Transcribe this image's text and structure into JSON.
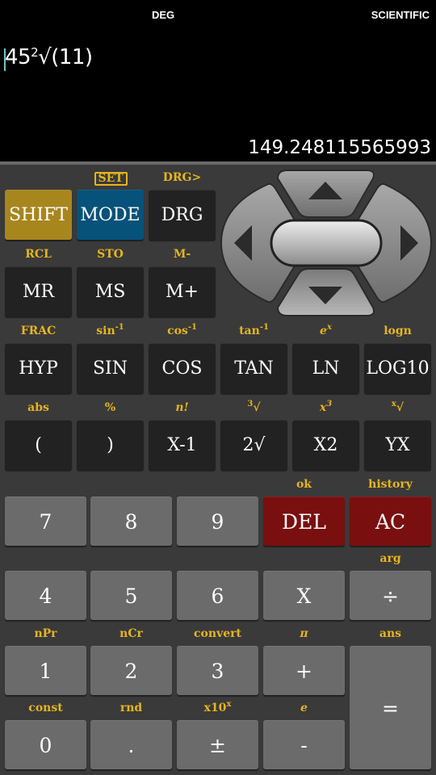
{
  "display": {
    "angle_mode": "DEG",
    "calc_mode": "SCIENTIFIC",
    "expression_base": "45",
    "expression_sup": "2",
    "expression_rest": "√(11)",
    "result": "149.248115565993"
  },
  "colors": {
    "shift_label": "#e6b51d",
    "shift_key": "#a8861e",
    "mode_key": "#06527a",
    "dark_key": "#222222",
    "number_key": "#6b6b6b",
    "red_key": "#7a0f0f"
  },
  "dpad": {
    "icons": [
      "arrow-up-icon",
      "arrow-down-icon",
      "arrow-left-icon",
      "arrow-right-icon"
    ]
  },
  "top_rows": [
    [
      {
        "label": "SHIFT",
        "style": "gold"
      },
      {
        "label": "MODE",
        "style": "blue",
        "shift": "SET",
        "boxed": true
      },
      {
        "label": "DRG",
        "style": "dark",
        "shift": "DRG>"
      }
    ],
    [
      {
        "label": "MR",
        "style": "dark",
        "shift": "RCL"
      },
      {
        "label": "MS",
        "style": "dark",
        "shift": "STO"
      },
      {
        "label": "M+",
        "style": "dark",
        "shift": "M-"
      }
    ],
    [
      {
        "label": "HYP",
        "style": "dark",
        "shift": "FRAC"
      },
      {
        "label": "SIN",
        "style": "dark",
        "shift": "sin",
        "shift_sup": "-1"
      },
      {
        "label": "COS",
        "style": "dark",
        "shift": "cos",
        "shift_sup": "-1"
      },
      {
        "label": "TAN",
        "style": "dark",
        "shift": "tan",
        "shift_sup": "-1"
      },
      {
        "label": "LN",
        "style": "dark",
        "shift": "e",
        "shift_sup": "x",
        "italic": true
      },
      {
        "label": "LOG10",
        "style": "dark",
        "shift": "logn"
      }
    ],
    [
      {
        "label": "(",
        "style": "dark",
        "shift": "abs"
      },
      {
        "label": ")",
        "style": "dark",
        "shift": "%"
      },
      {
        "label": "X-1",
        "style": "dark",
        "shift": "n!",
        "italic": true
      },
      {
        "label": "2√",
        "style": "dark",
        "shift": "√",
        "shift_pre": "3"
      },
      {
        "label": "X2",
        "style": "dark",
        "shift": "x",
        "shift_sup": "3",
        "italic": true
      },
      {
        "label": "YX",
        "style": "dark",
        "shift": "√",
        "shift_pre": "x"
      }
    ]
  ],
  "num_rows": [
    [
      {
        "label": "7",
        "style": "gray"
      },
      {
        "label": "8",
        "style": "gray"
      },
      {
        "label": "9",
        "style": "gray"
      },
      {
        "label": "DEL",
        "style": "red",
        "shift": "ok"
      },
      {
        "label": "AC",
        "style": "red",
        "shift": "history"
      }
    ],
    [
      {
        "label": "4",
        "style": "gray"
      },
      {
        "label": "5",
        "style": "gray"
      },
      {
        "label": "6",
        "style": "gray"
      },
      {
        "label": "X",
        "style": "gray"
      },
      {
        "label": "÷",
        "style": "gray",
        "shift": "arg"
      }
    ],
    [
      {
        "label": "1",
        "style": "gray",
        "shift": "nPr"
      },
      {
        "label": "2",
        "style": "gray",
        "shift": "nCr"
      },
      {
        "label": "3",
        "style": "gray",
        "shift": "convert"
      },
      {
        "label": "+",
        "style": "gray",
        "shift": "π",
        "italic": true
      },
      {
        "label": "=",
        "style": "gray",
        "shift": "ans",
        "tall": true
      }
    ],
    [
      {
        "label": "0",
        "style": "gray",
        "shift": "const"
      },
      {
        "label": ".",
        "style": "gray",
        "shift": "rnd"
      },
      {
        "label": "±",
        "style": "gray",
        "shift": "x10",
        "shift_sup": "x"
      },
      {
        "label": "-",
        "style": "gray",
        "shift": "e",
        "italic": true
      }
    ]
  ]
}
